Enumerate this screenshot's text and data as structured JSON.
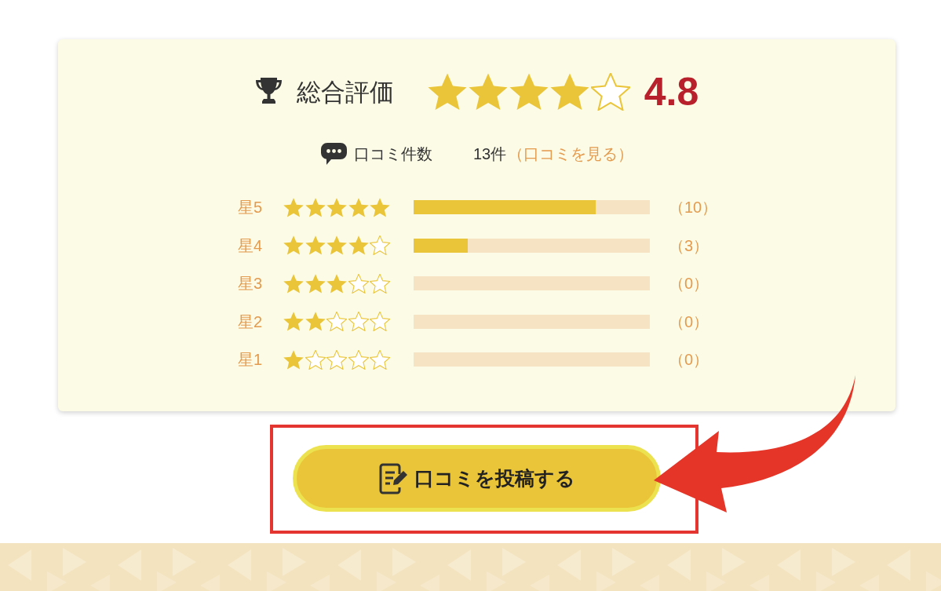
{
  "summary": {
    "label": "総合評価",
    "stars": 4,
    "score": "4.8"
  },
  "review_count": {
    "label": "口コミ件数",
    "count": "13件",
    "link": "（口コミを見る）"
  },
  "breakdown": [
    {
      "label": "星5",
      "stars": 5,
      "level": 0.77,
      "count": "（10）"
    },
    {
      "label": "星4",
      "stars": 4,
      "level": 0.23,
      "count": "（3）"
    },
    {
      "label": "星3",
      "stars": 3,
      "count": "（0）"
    },
    {
      "label": "星2",
      "stars": 2,
      "count": "（0）"
    },
    {
      "label": "星1",
      "stars": 1,
      "count": "（0）"
    }
  ],
  "post_button": {
    "label": "口コミを投稿する"
  }
}
